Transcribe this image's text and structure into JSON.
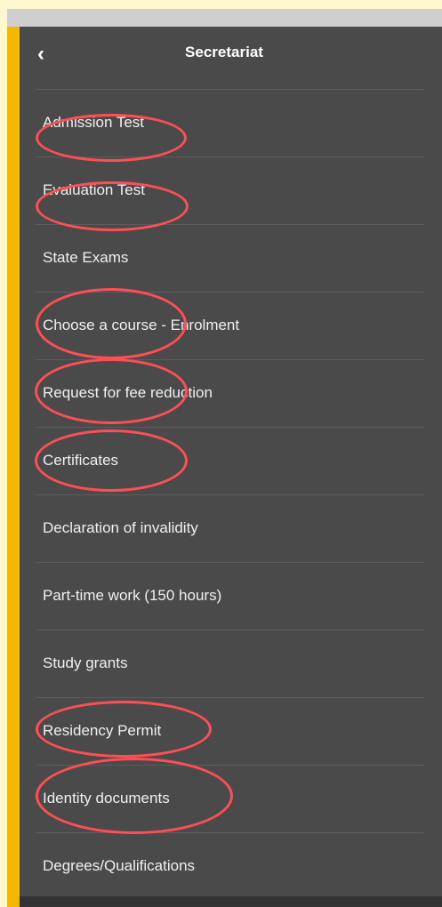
{
  "header": {
    "back_icon": "chevron-left-icon",
    "title": "Secretariat"
  },
  "menu": {
    "items": [
      {
        "label": "Admission Test",
        "highlighted": true
      },
      {
        "label": "Evaluation Test",
        "highlighted": true
      },
      {
        "label": "State Exams",
        "highlighted": false
      },
      {
        "label": "Choose a course - Enrolment",
        "highlighted": true
      },
      {
        "label": "Request for fee reduction",
        "highlighted": true
      },
      {
        "label": "Certificates",
        "highlighted": true
      },
      {
        "label": "Declaration of invalidity",
        "highlighted": false
      },
      {
        "label": "Part-time work (150 hours)",
        "highlighted": false
      },
      {
        "label": "Study grants",
        "highlighted": false
      },
      {
        "label": "Residency Permit",
        "highlighted": true
      },
      {
        "label": "Identity documents",
        "highlighted": true
      },
      {
        "label": "Degrees/Qualifications",
        "highlighted": false
      }
    ]
  },
  "colors": {
    "panel": "#4a4a4a",
    "accent": "#f5b800",
    "highlight": "#ff4f55"
  }
}
